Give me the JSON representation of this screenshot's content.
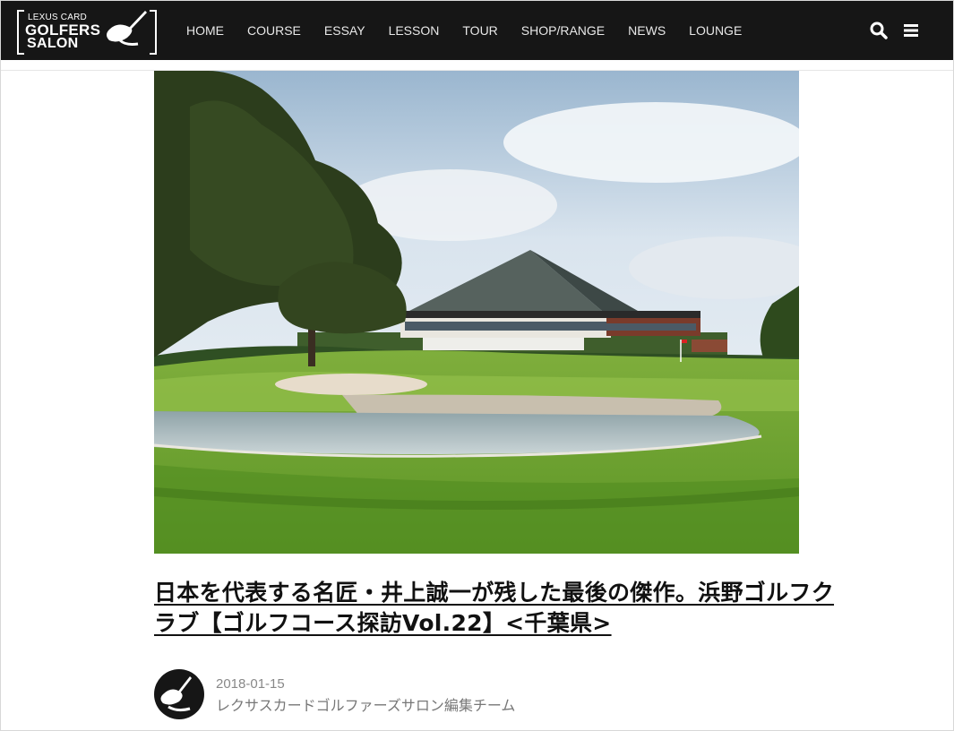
{
  "header": {
    "logo": {
      "line1": "LEXUS CARD",
      "line2": "GOLFERS",
      "line3": "SALON"
    },
    "menu": [
      {
        "label": "HOME"
      },
      {
        "label": "COURSE"
      },
      {
        "label": "ESSAY"
      },
      {
        "label": "LESSON"
      },
      {
        "label": "TOUR"
      },
      {
        "label": "SHOP/RANGE"
      },
      {
        "label": "NEWS"
      },
      {
        "label": "LOUNGE"
      }
    ],
    "icons": [
      "search-icon",
      "hamburger-menu-icon"
    ],
    "background": "#161616"
  },
  "article": {
    "hero_image": "golf-course-clubhouse-photo",
    "title": "日本を代表する名匠・井上誠一が残した最後の傑作。浜野ゴルフクラブ【ゴルフコース探訪Vol.22】<千葉県>",
    "date": "2018-01-15",
    "author": "レクサスカードゴルファーズサロン編集チーム"
  }
}
